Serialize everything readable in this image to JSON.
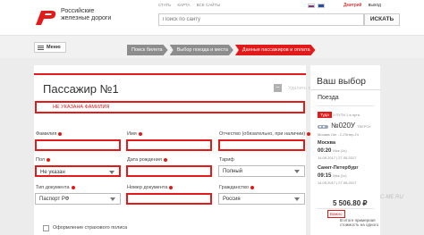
{
  "header": {
    "brand_line1": "Российские",
    "brand_line2": "железные дороги",
    "links": [
      "СТАТЬ",
      "КАРТА",
      "ВСЕ САЙТЫ"
    ],
    "user_name": "Дмитрий",
    "logout_label": "выход",
    "search_placeholder": "Поиск по сайту",
    "search_button": "ИСКАТЬ",
    "brand_color": "#e21a1a"
  },
  "nav": {
    "menu_label": "Меню",
    "steps": [
      {
        "label": "Поиск билета",
        "active": false
      },
      {
        "label": "Выбор поезда и места",
        "active": false
      },
      {
        "label": "Данные пассажиров и оплата",
        "active": true
      }
    ]
  },
  "passenger": {
    "title": "Пассажир №1",
    "delete_label": "Удалить пассажира",
    "error_message": "НЕ УКАЗАНА ФАМИЛИЯ",
    "fields": {
      "surname_label": "Фамилия",
      "surname_value": "",
      "name_label": "Имя",
      "name_value": "",
      "patronymic_label": "Отчество (обязательно, при наличии)",
      "patronymic_value": "",
      "sex_label": "Пол",
      "sex_value": "Не указан",
      "birth_label": "Дата рождения",
      "birth_value": "",
      "tariff_label": "Тариф",
      "tariff_value": "Полный",
      "doc_type_label": "Тип документа",
      "doc_type_value": "Паспорт РФ",
      "doc_number_label": "Номер документа",
      "doc_number_value": "",
      "citizenship_label": "Гражданство",
      "citizenship_value": "Россия"
    },
    "insurance_label": "Оформление страхового полиса"
  },
  "summary": {
    "title": "Ваш выбор",
    "subtitle": "Поезда",
    "direction_tag": "Туда",
    "passengers_info": "1 ПУТИ 1 в пути",
    "train_number": "№020У",
    "train_type": "ТВЕРСК",
    "route": "Москва Окт - С-Петер-Гл",
    "departure_city": "Москва",
    "departure_time": "00:20",
    "departure_note": "Мск (1ч)",
    "departure_date": "14.09.2017 | 27.05.2017",
    "arrival_city": "Санкт-Петербург",
    "arrival_time": "09:15",
    "arrival_note": "Мск (1ч)",
    "arrival_date": "14.09.2017 | 27.05.2017",
    "price": "5 506.80 ₽",
    "important_badge": "Важно",
    "note": "В итоге примерная стоимость на одного"
  },
  "watermark": "C-ME.RU"
}
